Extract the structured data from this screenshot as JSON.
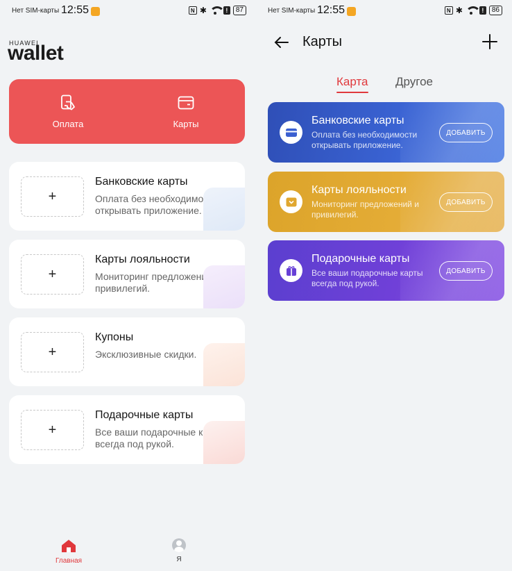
{
  "status_left": {
    "carrier": "Нет SIM-карты",
    "time": "12:55",
    "nfc": "N",
    "alert": "!",
    "battery": "87"
  },
  "status_right": {
    "carrier": "Нет SIM-карты",
    "time": "12:55",
    "nfc": "N",
    "alert": "!",
    "battery": "86"
  },
  "home": {
    "brand_small": "HUAWEI",
    "brand_big": "wallet",
    "quick_actions": [
      {
        "label": "Оплата",
        "icon": "payment-icon"
      },
      {
        "label": "Карты",
        "icon": "wallet-card-icon"
      }
    ],
    "add_symbol": "+",
    "cards": [
      {
        "title": "Банковские карты",
        "subtitle": "Оплата без необходимости открывать приложение.",
        "color": "#e6eef9"
      },
      {
        "title": "Карты лояльности",
        "subtitle": "Мониторинг предложений и привилегий.",
        "color": "#f1e9fb"
      },
      {
        "title": "Купоны",
        "subtitle": "Эксклюзивные скидки.",
        "color": "#fdeee7"
      },
      {
        "title": "Подарочные карты",
        "subtitle": "Все ваши подарочные карты всегда под рукой.",
        "color": "#fdecea"
      }
    ],
    "nav": {
      "home_label": "Главная",
      "me_label": "Я"
    }
  },
  "cards_page": {
    "title": "Карты",
    "tabs": [
      {
        "label": "Карта",
        "active": true
      },
      {
        "label": "Другое",
        "active": false
      }
    ],
    "promos": [
      {
        "title": "Банковские карты",
        "subtitle": "Оплата без необходимости открывать приложение.",
        "button": "ДОБАВИТЬ",
        "icon": "bank-card-icon",
        "color": "#3a5fd0"
      },
      {
        "title": "Карты лояльности",
        "subtitle": "Мониторинг предложений и привилегий.",
        "button": "ДОБАВИТЬ",
        "icon": "loyalty-card-icon",
        "color": "#e0a730"
      },
      {
        "title": "Подарочные карты",
        "subtitle": "Все ваши подарочные карты всегда под рукой.",
        "button": "ДОБАВИТЬ",
        "icon": "gift-icon",
        "color": "#6740d6"
      }
    ]
  },
  "colors": {
    "accent": "#e0383c",
    "red_panel": "#ec5556",
    "background": "#f1f3f5"
  }
}
